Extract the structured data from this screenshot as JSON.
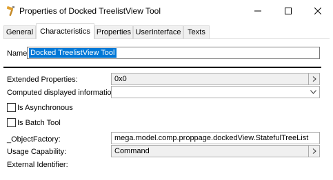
{
  "window": {
    "title": "Properties of Docked TreelistView Tool",
    "icon": "wrench-hammer-icon"
  },
  "tabs": [
    {
      "label": "General",
      "active": false
    },
    {
      "label": "Characteristics",
      "active": true
    },
    {
      "label": "Properties",
      "active": false
    },
    {
      "label": "UserInterface",
      "active": false
    },
    {
      "label": "Texts",
      "active": false
    }
  ],
  "name": {
    "label": "Name:",
    "value": "Docked TreelistView Tool"
  },
  "properties": {
    "extended": {
      "label": "Extended Properties:",
      "value": "0x0"
    },
    "computed": {
      "label": "Computed displayed information:",
      "value": ""
    },
    "async": {
      "label": "Is Asynchronous",
      "checked": false
    },
    "batch": {
      "label": "Is Batch Tool",
      "checked": false
    },
    "objectFactory": {
      "label": "_ObjectFactory:",
      "value": "mega.model.comp.proppage.dockedView.StatefulTreeList"
    },
    "usage": {
      "label": "Usage Capability:",
      "value": "Command"
    },
    "externalId": {
      "label": "External Identifier:"
    }
  },
  "colors": {
    "selection": "#0078d7"
  }
}
